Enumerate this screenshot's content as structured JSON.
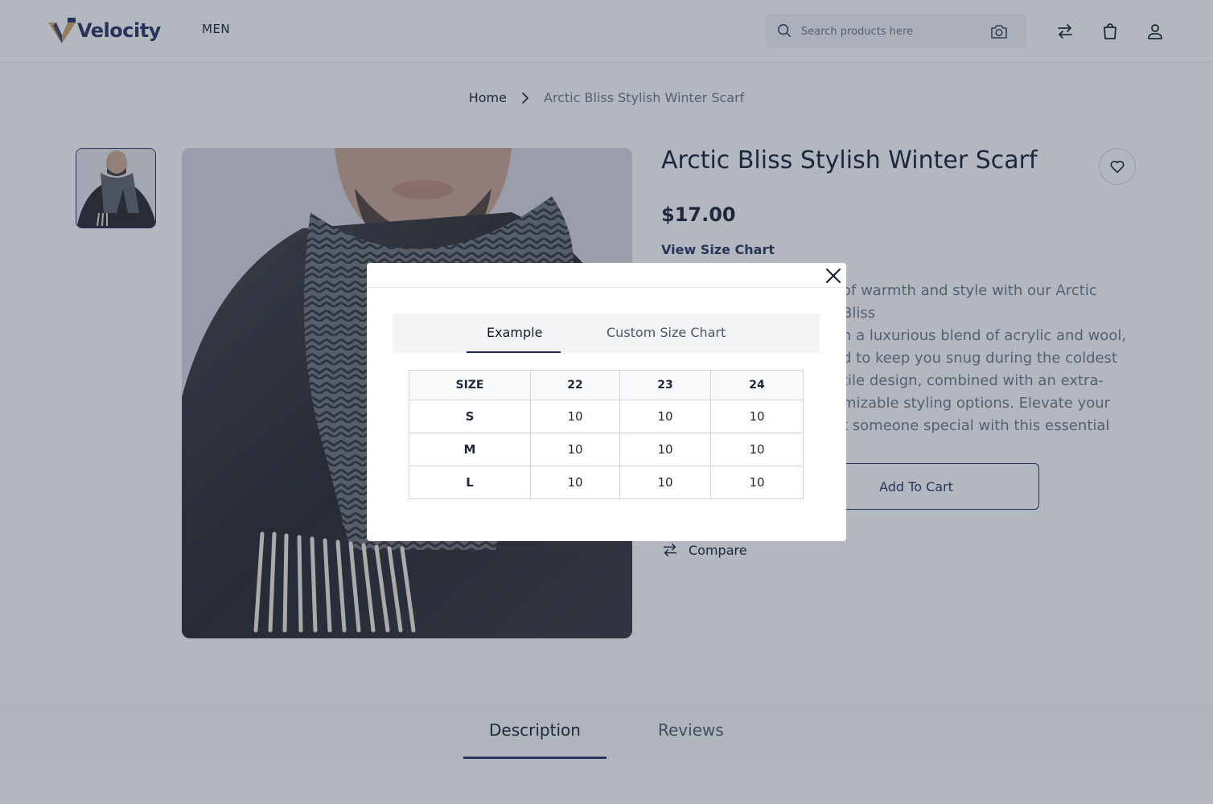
{
  "brand": {
    "name": "Velocity",
    "primary_color": "#1e2a5a",
    "accent_color": "#c9a45c"
  },
  "nav": {
    "men_label": "MEN"
  },
  "search": {
    "placeholder": "Search products here",
    "icon": "search-icon",
    "camera_icon": "camera-icon"
  },
  "header_icons": [
    "compare-arrows-icon",
    "shopping-bag-icon",
    "user-icon"
  ],
  "breadcrumb": {
    "home": "Home",
    "current": "Arctic Bliss Stylish Winter Scarf"
  },
  "product": {
    "title": "Arctic Bliss Stylish Winter Scarf",
    "price": "$17.00",
    "size_chart_link": "View Size Chart",
    "description_lines": [
      "of warmth and style with our Arctic Bliss",
      "n a luxurious blend of acrylic and wool,",
      "d to keep you snug during the coldest",
      "tile design, combined with an extra-",
      "mizable styling options. Elevate your",
      "t someone special with this essential"
    ],
    "add_to_cart_label": "Add To Cart",
    "compare_label": "Compare"
  },
  "tabs": {
    "description": "Description",
    "reviews": "Reviews"
  },
  "modal": {
    "tabs": {
      "example": "Example",
      "custom": "Custom Size Chart"
    },
    "table": {
      "headers": [
        "SIZE",
        "22",
        "23",
        "24"
      ],
      "rows": [
        {
          "size": "S",
          "values": [
            "10",
            "10",
            "10"
          ]
        },
        {
          "size": "M",
          "values": [
            "10",
            "10",
            "10"
          ]
        },
        {
          "size": "L",
          "values": [
            "10",
            "10",
            "10"
          ]
        }
      ]
    }
  }
}
